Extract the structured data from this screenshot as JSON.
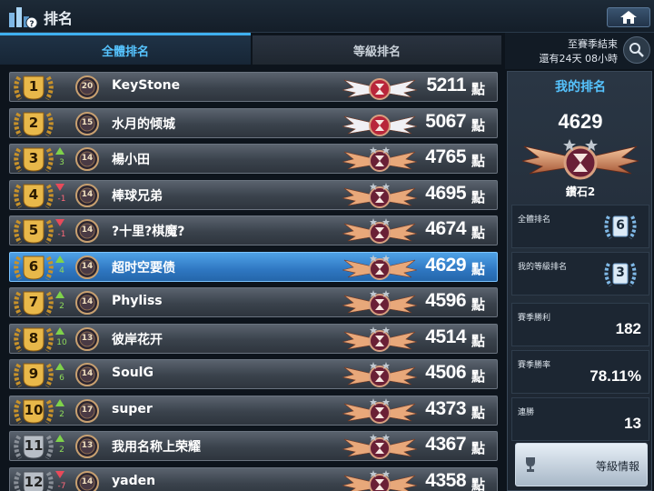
{
  "header": {
    "title": "排名"
  },
  "tabs": [
    {
      "label": "全體排名",
      "active": true
    },
    {
      "label": "等級排名",
      "active": false
    }
  ],
  "season": {
    "line1": "至賽季結束",
    "line2": "還有24天 08小時"
  },
  "points_unit": "點",
  "rows": [
    {
      "rank": "1",
      "trend": "",
      "trend_val": "",
      "level": "20",
      "name": "KeyStone",
      "score": "5211",
      "medal": "gold",
      "tier": "top",
      "me": false
    },
    {
      "rank": "2",
      "trend": "",
      "trend_val": "",
      "level": "15",
      "name": "水月的倾城",
      "score": "5067",
      "medal": "gold",
      "tier": "top",
      "me": false
    },
    {
      "rank": "3",
      "trend": "up",
      "trend_val": "3",
      "level": "14",
      "name": "楊小田",
      "score": "4765",
      "medal": "gold",
      "tier": "diamond",
      "me": false
    },
    {
      "rank": "4",
      "trend": "down",
      "trend_val": "-1",
      "level": "14",
      "name": "棒球兄弟",
      "score": "4695",
      "medal": "gold",
      "tier": "diamond",
      "me": false
    },
    {
      "rank": "5",
      "trend": "down",
      "trend_val": "-1",
      "level": "14",
      "name": "?十里?棋魔?",
      "score": "4674",
      "medal": "gold",
      "tier": "diamond",
      "me": false
    },
    {
      "rank": "6",
      "trend": "up",
      "trend_val": "4",
      "level": "14",
      "name": "超时空要债",
      "score": "4629",
      "medal": "gold",
      "tier": "diamond",
      "me": true
    },
    {
      "rank": "7",
      "trend": "up",
      "trend_val": "2",
      "level": "14",
      "name": "Phyliss",
      "score": "4596",
      "medal": "gold",
      "tier": "diamond",
      "me": false
    },
    {
      "rank": "8",
      "trend": "up",
      "trend_val": "10",
      "level": "13",
      "name": "彼岸花开",
      "score": "4514",
      "medal": "gold",
      "tier": "diamond",
      "me": false
    },
    {
      "rank": "9",
      "trend": "up",
      "trend_val": "6",
      "level": "14",
      "name": "SoulG",
      "score": "4506",
      "medal": "gold",
      "tier": "diamond",
      "me": false
    },
    {
      "rank": "10",
      "trend": "up",
      "trend_val": "2",
      "level": "17",
      "name": "super",
      "score": "4373",
      "medal": "gold",
      "tier": "diamond",
      "me": false
    },
    {
      "rank": "11",
      "trend": "up",
      "trend_val": "2",
      "level": "13",
      "name": "我用名称上荣耀",
      "score": "4367",
      "medal": "silver",
      "tier": "diamond",
      "me": false
    },
    {
      "rank": "12",
      "trend": "down",
      "trend_val": "-7",
      "level": "14",
      "name": "yaden",
      "score": "4358",
      "medal": "silver",
      "tier": "diamond",
      "me": false
    }
  ],
  "my_rank": {
    "title": "我的排名",
    "score": "4629",
    "tier_name": "鑽石2",
    "overall_rank_label": "全體排名",
    "overall_rank": "6",
    "level_rank_label": "我的等級排名",
    "level_rank": "3",
    "wins_label": "賽季勝利",
    "wins": "182",
    "winrate_label": "賽季勝率",
    "winrate": "78.11%",
    "streak_label": "連勝",
    "streak": "13",
    "level_info_button": "等級情報"
  },
  "colors": {
    "accent": "#3fb0f0",
    "my_title": "#56c4ff",
    "me_row": "#2f77c2",
    "up": "#7fd34a",
    "down": "#e84a5a"
  }
}
